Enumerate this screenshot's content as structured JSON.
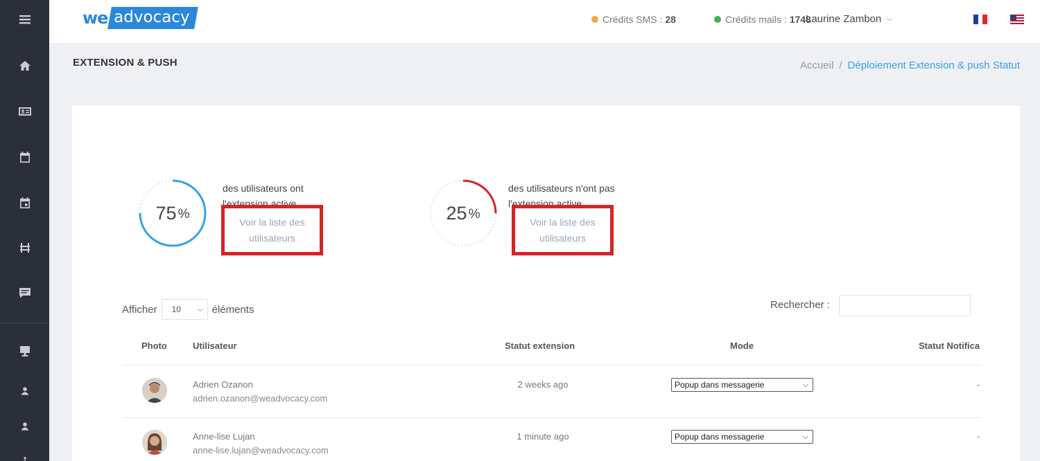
{
  "header": {
    "logo_we": "we",
    "logo_advocacy": "advocacy",
    "credits_sms_label": "Crédits SMS :",
    "credits_sms_value": "28",
    "credits_mails_label": "Crédits mails :",
    "credits_mails_value": "1748",
    "user_name": "Laurine Zambon",
    "colors": {
      "sms_dot": "#f0a44b",
      "mail_dot": "#3bb44a"
    }
  },
  "page": {
    "title": "EXTENSION & PUSH",
    "breadcrumb_home": "Accueil",
    "breadcrumb_sep": "/",
    "breadcrumb_current": "Déploiement Extension & push Statut"
  },
  "stats": [
    {
      "percent": 75,
      "percent_text": "75",
      "unit": "%",
      "text": "des utilisateurs ont l'extension active",
      "link": "Voir la liste des utilisateurs",
      "color": "#3aa0e4"
    },
    {
      "percent": 25,
      "percent_text": "25",
      "unit": "%",
      "text": "des utilisateurs n'ont pas l'extension active",
      "link": "Voir la liste des utilisateurs",
      "color": "#d42426"
    }
  ],
  "table_controls": {
    "show_label": "Afficher",
    "page_size": "10",
    "elements_label": "éléments",
    "search_label": "Rechercher :"
  },
  "table": {
    "columns": [
      "Photo",
      "Utilisateur",
      "Statut extension",
      "Mode",
      "Statut Notifica"
    ],
    "rows": [
      {
        "name": "Adrien Ozanon",
        "email": "adrien.ozanon@weadvocacy.com",
        "status": "2 weeks ago",
        "mode": "Popup dans messagerie",
        "notif": "-"
      },
      {
        "name": "Anne-lise Lujan",
        "email": "anne-lise.lujan@weadvocacy.com",
        "status": "1 minute ago",
        "mode": "Popup dans messagerie",
        "notif": "-"
      }
    ]
  }
}
